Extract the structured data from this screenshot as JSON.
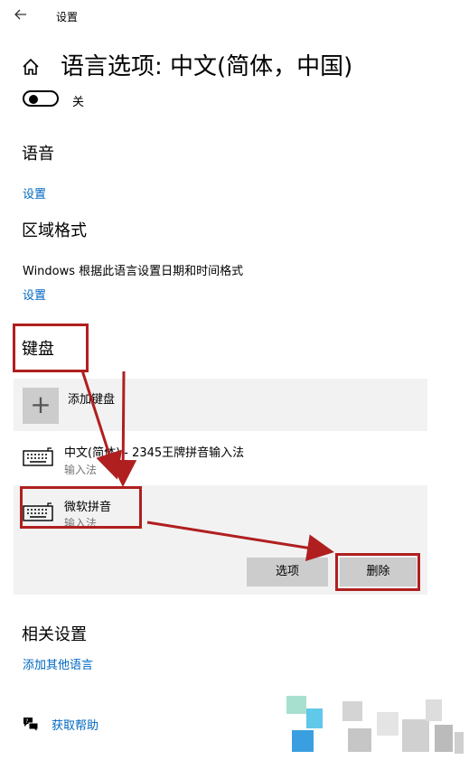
{
  "window": {
    "title": "设置",
    "back_icon": "back-arrow-icon"
  },
  "header": {
    "page_title": "语言选项: 中文(简体，中国)",
    "home_icon": "home-icon",
    "toggle_state": "off",
    "toggle_label": "关"
  },
  "speech": {
    "heading": "语音",
    "link": "设置"
  },
  "region": {
    "heading": "区域格式",
    "description": "Windows 根据此语言设置日期和时间格式",
    "link": "设置"
  },
  "keyboard": {
    "heading": "键盘",
    "add_label": "添加键盘",
    "items": [
      {
        "title": "中文(简体) - 2345王牌拼音输入法",
        "subtitle": "输入法"
      },
      {
        "title": "微软拼音",
        "subtitle": "输入法"
      }
    ],
    "options_button": "选项",
    "delete_button": "删除"
  },
  "related": {
    "heading": "相关设置",
    "link": "添加其他语言"
  },
  "help": {
    "link": "获取帮助",
    "icon": "help-chat-icon"
  },
  "colors": {
    "accent_link": "#0067c0",
    "annotation": "#b01f1f",
    "panel_bg": "#f2f2f2",
    "button_bg": "#cccccc"
  }
}
